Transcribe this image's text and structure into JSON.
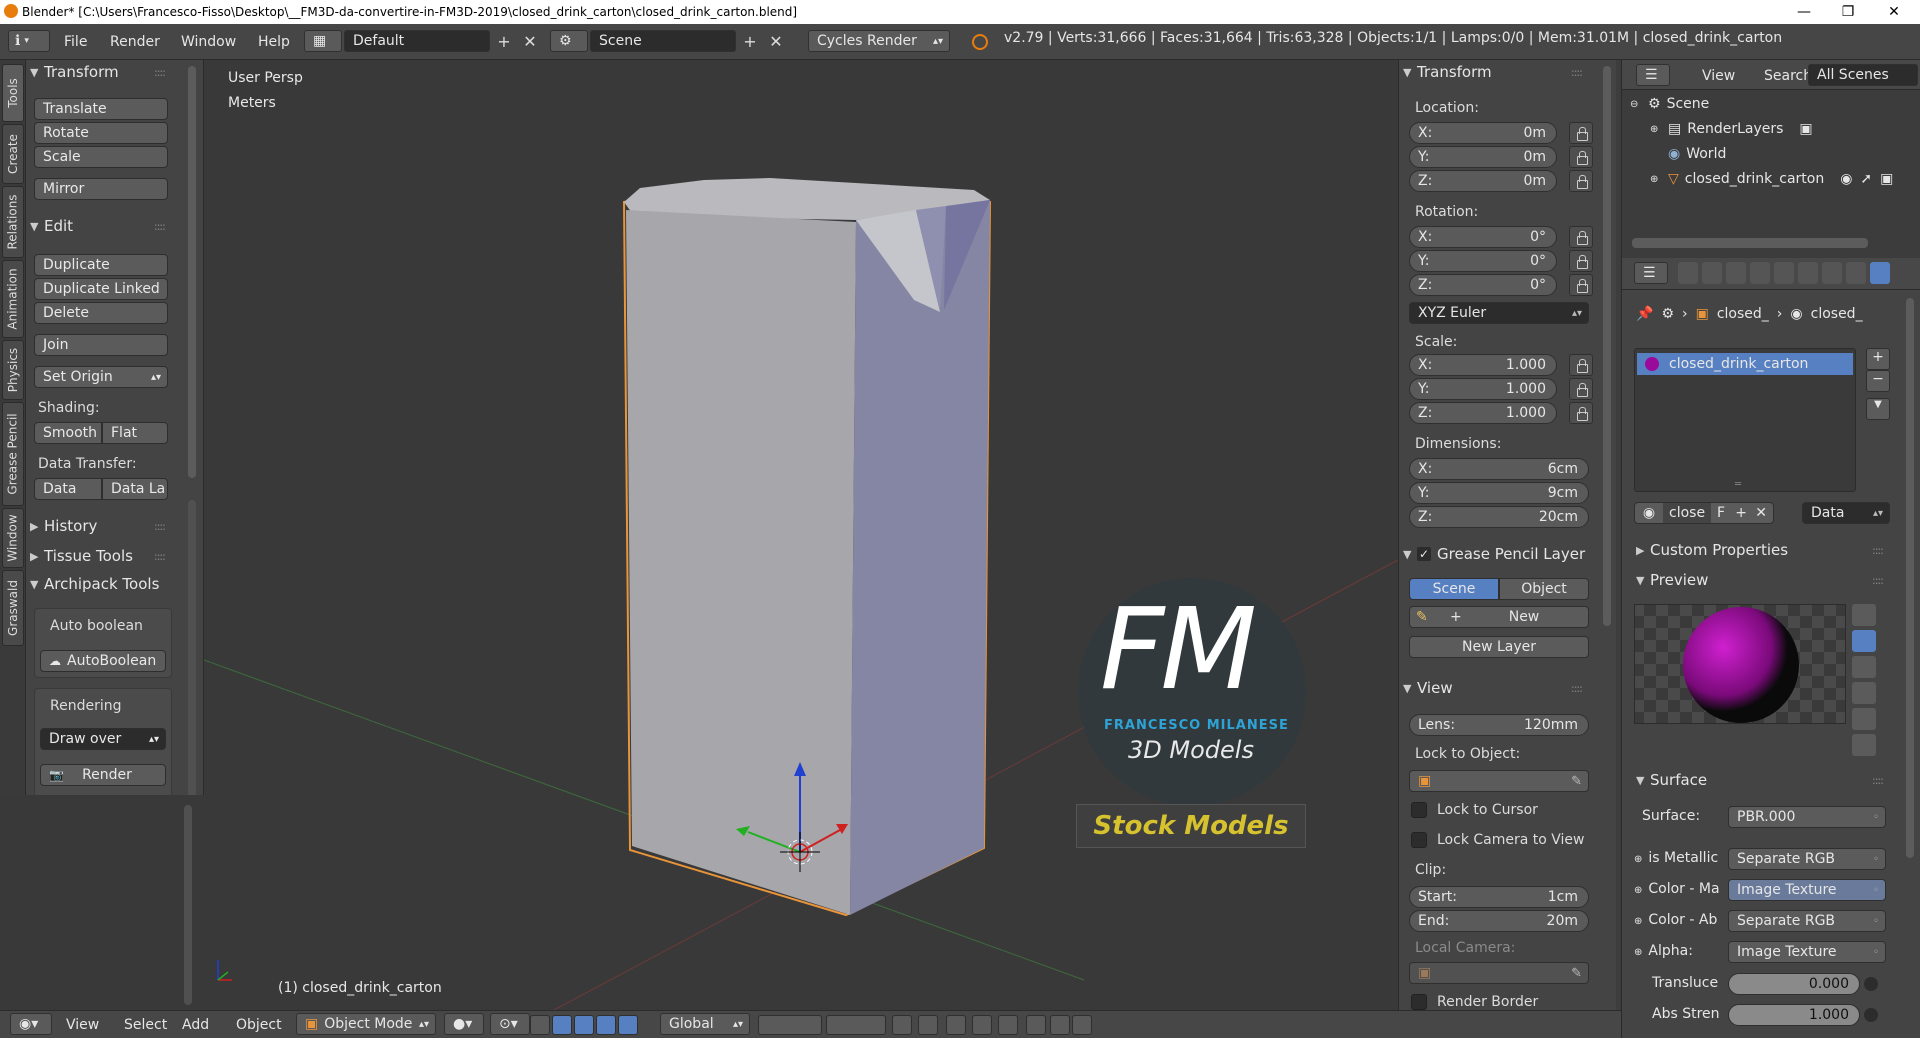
{
  "titlebar": {
    "title": "Blender* [C:\\Users\\Francesco-Fisso\\Desktop\\__FM3D-da-convertire-in-FM3D-2019\\closed_drink_carton\\closed_drink_carton.blend]",
    "minimize": "—",
    "maximize": "❐",
    "close": "✕"
  },
  "menubar": {
    "info_icon": "ℹ",
    "items": [
      "File",
      "Render",
      "Window",
      "Help"
    ],
    "layout": "Default",
    "scene": "Scene",
    "engine": "Cycles Render",
    "stats": "v2.79 | Verts:31,666 | Faces:31,664 | Tris:63,328 | Objects:1/1 | Lamps:0/0 | Mem:31.01M | closed_drink_carton"
  },
  "vertical_tabs": [
    "Tools",
    "Create",
    "Relations",
    "Animation",
    "Physics",
    "Grease Pencil",
    "Window",
    "Graswald"
  ],
  "toolshelf": {
    "transform_header": "Transform",
    "translate": "Translate",
    "rotate": "Rotate",
    "scale": "Scale",
    "mirror": "Mirror",
    "edit_header": "Edit",
    "duplicate": "Duplicate",
    "duplicate_linked": "Duplicate Linked",
    "delete": "Delete",
    "join": "Join",
    "set_origin": "Set Origin",
    "shading_label": "Shading:",
    "smooth": "Smooth",
    "flat": "Flat",
    "data_transfer_label": "Data Transfer:",
    "data": "Data",
    "data_la": "Data La",
    "history": "History",
    "tissue_tools": "Tissue Tools",
    "archipack_tools": "Archipack Tools",
    "auto_boolean_label": "Auto boolean",
    "auto_boolean_btn": "AutoBoolean",
    "rendering_label": "Rendering",
    "draw_over": "Draw over",
    "render": "Render"
  },
  "viewport": {
    "view_name": "User Persp",
    "units": "Meters",
    "active_object": "(1) closed_drink_carton",
    "watermark": {
      "logo_letters": "FM",
      "author": "FRANCESCO MILANESE",
      "product": "3D Models",
      "tag": "Stock Models"
    }
  },
  "npanel": {
    "transform_header": "Transform",
    "location_label": "Location:",
    "location": [
      {
        "axis": "X:",
        "value": "0m"
      },
      {
        "axis": "Y:",
        "value": "0m"
      },
      {
        "axis": "Z:",
        "value": "0m"
      }
    ],
    "rotation_label": "Rotation:",
    "rotation": [
      {
        "axis": "X:",
        "value": "0°"
      },
      {
        "axis": "Y:",
        "value": "0°"
      },
      {
        "axis": "Z:",
        "value": "0°"
      }
    ],
    "rotation_mode": "XYZ Euler",
    "scale_label": "Scale:",
    "scale": [
      {
        "axis": "X:",
        "value": "1.000"
      },
      {
        "axis": "Y:",
        "value": "1.000"
      },
      {
        "axis": "Z:",
        "value": "1.000"
      }
    ],
    "dimensions_label": "Dimensions:",
    "dimensions": [
      {
        "axis": "X:",
        "value": "6cm"
      },
      {
        "axis": "Y:",
        "value": "9cm"
      },
      {
        "axis": "Z:",
        "value": "20cm"
      }
    ],
    "grease_pencil_header": "Grease Pencil Layer",
    "scene_btn": "Scene",
    "object_btn": "Object",
    "new_btn": "New",
    "new_layer_btn": "New Layer",
    "view_header": "View",
    "lens_label": "Lens:",
    "lens_value": "120mm",
    "lock_to_object_label": "Lock to Object:",
    "lock_to_cursor": "Lock to Cursor",
    "lock_camera_to_view": "Lock Camera to View",
    "clip_label": "Clip:",
    "clip_start_label": "Start:",
    "clip_start": "1cm",
    "clip_end_label": "End:",
    "clip_end": "20m",
    "local_camera_label": "Local Camera:",
    "render_border": "Render Border"
  },
  "outliner": {
    "view": "View",
    "search": "Search",
    "filter": "All Scenes",
    "items": [
      "Scene",
      "RenderLayers",
      "World",
      "closed_drink_carton"
    ]
  },
  "properties": {
    "breadcrumb_obj": "closed_",
    "breadcrumb_mat": "closed_",
    "material_slot": "closed_drink_carton",
    "material_name": "close",
    "material_fake": "F",
    "link": "Data",
    "custom_properties": "Custom Properties",
    "preview": "Preview",
    "surface_header": "Surface",
    "surface_label": "Surface:",
    "surface_value": "PBR.000",
    "inputs": [
      {
        "label": "is Metallic",
        "value": "Separate RGB"
      },
      {
        "label": "Color - Ma",
        "value": "Image Texture"
      },
      {
        "label": "Color - Ab",
        "value": "Separate RGB"
      },
      {
        "label": "Alpha:",
        "value": "Image Texture"
      }
    ],
    "transluce_label": "Transluce",
    "transluce_value": "0.000",
    "abs_stren_label": "Abs Stren",
    "abs_stren_value": "1.000"
  },
  "bottombar": {
    "view": "View",
    "select": "Select",
    "add": "Add",
    "object": "Object",
    "mode": "Object Mode",
    "orientation": "Global"
  },
  "colors": {
    "accent_blue": "#5680c2",
    "selection_orange": "#e8943a",
    "watermark_blue": "#2ea3d6",
    "watermark_yellow": "#d6c22e"
  }
}
